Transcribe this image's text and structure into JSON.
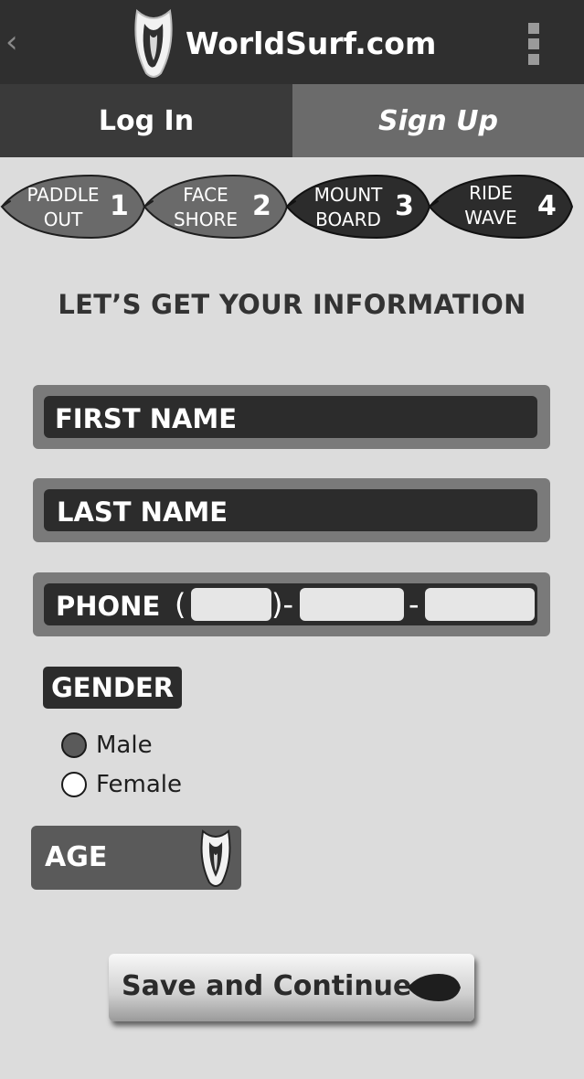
{
  "header": {
    "back_icon": "chevron-left-icon",
    "logo_icon": "surfboard-fin-icon",
    "brand": "WorldSurf.com",
    "menu_icon": "kebab-menu-icon"
  },
  "tabs": [
    {
      "label": "Log In",
      "active": false
    },
    {
      "label": "Sign Up",
      "active": true
    }
  ],
  "steps": [
    {
      "line1": "PADDLE",
      "line2": "OUT",
      "number": "1"
    },
    {
      "line1": "FACE",
      "line2": "SHORE",
      "number": "2"
    },
    {
      "line1": "MOUNT",
      "line2": "BOARD",
      "number": "3"
    },
    {
      "line1": "RIDE",
      "line2": "WAVE",
      "number": "4"
    }
  ],
  "form": {
    "heading": "LET’S GET YOUR INFORMATION",
    "first_name_label": "FIRST NAME",
    "last_name_label": "LAST NAME",
    "phone_label": "PHONE",
    "phone_open_paren": "(",
    "phone_close_paren": ")-",
    "phone_dash": "-",
    "gender_label": "GENDER",
    "gender_options": [
      {
        "label": "Male",
        "selected": true
      },
      {
        "label": "Female",
        "selected": false
      }
    ],
    "age_label": "AGE",
    "age_icon": "surfboard-dropdown-icon",
    "save_label": "Save and Continue",
    "save_icon": "surfboard-arrow-icon"
  },
  "colors": {
    "header_bg": "#2f2f2f",
    "tab_active_bg": "#6b6b6b",
    "page_bg": "#dcdcdc",
    "field_dark": "#2c2c2c"
  }
}
